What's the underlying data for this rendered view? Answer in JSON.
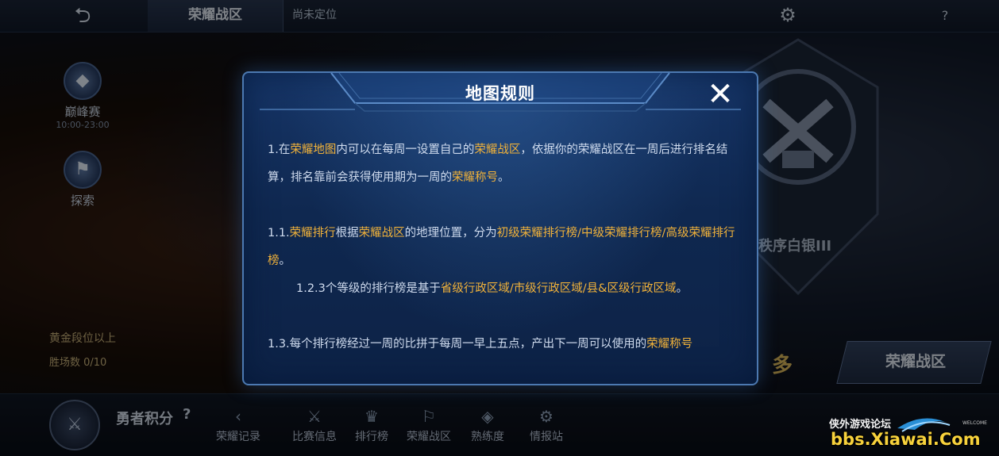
{
  "topbar": {
    "back_icon": "back-arrow-icon",
    "tab_label": "荣耀战区",
    "location_text": "尚未定位",
    "settings_icon": "gear-icon",
    "help_label": "?"
  },
  "left": {
    "peak_label": "巅峰赛",
    "peak_sub": "10:00-23:00",
    "explore_label": "探索",
    "gold_requirement": "黄金段位以上",
    "win_count": "胜场数 0/10"
  },
  "emblem": {
    "rank_text": "秩序白银III",
    "zone_button_label": "荣耀战区",
    "duo_text": "多"
  },
  "bottom": {
    "hero_points_label": "勇者积分",
    "hero_help": "?",
    "nav": [
      {
        "label": "荣耀记录",
        "icon": "‹"
      },
      {
        "label": "比赛信息",
        "icon": "⚔"
      },
      {
        "label": "排行榜",
        "icon": "♛"
      },
      {
        "label": "荣耀战区",
        "icon": "⚐"
      },
      {
        "label": "熟练度",
        "icon": "◈"
      },
      {
        "label": "情报站",
        "icon": "⚙"
      }
    ]
  },
  "modal": {
    "title": "地图规则",
    "close_label": "✕",
    "rules": {
      "r1": {
        "a": "1.在",
        "b": "荣耀地图",
        "c": "内可以在每周一设置自己的",
        "d": "荣耀战区",
        "e": "，依据你的荣耀战区在一周后进行排名结算，排名靠前会获得使用期为一周的",
        "f": "荣耀称号",
        "g": "。"
      },
      "r11": {
        "a": "1.1.",
        "b": "荣耀排行",
        "c": "根据",
        "d": "荣耀战区",
        "e": "的地理位置，分为",
        "f": "初级荣耀排行榜/中级荣耀排行榜/高级荣耀排行榜",
        "g": "。"
      },
      "r12": {
        "a": "1.2.3个等级的排行榜是基于",
        "b": "省级行政区域/市级行政区域/县&区级行政区域",
        "c": "。"
      },
      "r13": {
        "a": "1.3.每个排行榜经过一周的比拼于每周一早上五点，产出下一周可以使用的",
        "b": "荣耀称号"
      }
    }
  },
  "watermark": {
    "cn": "侠外游戏论坛",
    "url": "bbs.Xiawai.Com",
    "welcome": "WELCOME"
  },
  "colors": {
    "highlight": "#f1b23a",
    "modal_bg": "#0f2850",
    "modal_border": "#4c79b1"
  }
}
